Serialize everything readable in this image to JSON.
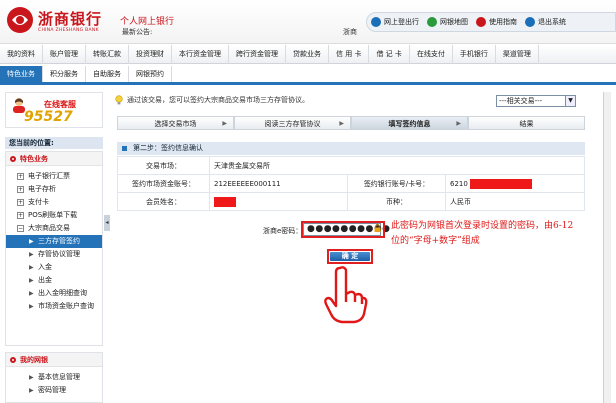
{
  "header": {
    "bank_name": "浙商银行",
    "bank_name_en": "CHINA ZHESHANG BANK",
    "site_title": "个人网上银行",
    "last_login_label": "最新公告:",
    "user_fragment": "浙商",
    "top_links": [
      {
        "label": "网上登出行",
        "icon": "user-icon",
        "color": "#1a6fb8"
      },
      {
        "label": "网银地图",
        "icon": "map-icon",
        "color": "#2a9a3a"
      },
      {
        "label": "使用指南",
        "icon": "help-icon",
        "color": "#c9161d"
      },
      {
        "label": "退出系统",
        "icon": "exit-icon",
        "color": "#1a6fb8"
      }
    ]
  },
  "nav_primary": [
    "我的资料",
    "账户管理",
    "转账汇款",
    "投资理财",
    "本行资金管理",
    "跨行资金管理",
    "贷款业务",
    "信 用 卡",
    "借 记 卡",
    "在线支付",
    "手机银行",
    "渠道管理"
  ],
  "nav_secondary": [
    {
      "label": "特色业务",
      "active": true
    },
    {
      "label": "积分服务",
      "active": false
    },
    {
      "label": "自助服务",
      "active": false
    },
    {
      "label": "网银预约",
      "active": false
    }
  ],
  "sidebar": {
    "customer_service_title": "在线客服",
    "customer_service_phone": "95527",
    "location_label": "您当前的位置:",
    "section_title": "特色业务",
    "items": [
      {
        "label": "电子银行汇票",
        "level": 1
      },
      {
        "label": "电子存析",
        "level": 1
      },
      {
        "label": "支付卡",
        "level": 1
      },
      {
        "label": "POS刷账单下载",
        "level": 1
      },
      {
        "label": "大宗商品交易",
        "level": 1
      },
      {
        "label": "三方存管签约",
        "level": 2,
        "active": true
      },
      {
        "label": "存管协议管理",
        "level": 2
      },
      {
        "label": "入金",
        "level": 2
      },
      {
        "label": "出金",
        "level": 2
      },
      {
        "label": "出入金明细查询",
        "level": 2
      },
      {
        "label": "市场资金账户查询",
        "level": 2
      }
    ],
    "section2_title": "我的网银",
    "items2": [
      "基本信息管理",
      "密码管理"
    ]
  },
  "main": {
    "notice": "通过该交易，您可以签约大宗商品交易市场三方存管协议。",
    "market_select_value": "---相关交易---",
    "steps": [
      "选择交易市场",
      "阅读三方存管协议",
      "填写签约信息",
      "结果"
    ],
    "active_step": 2,
    "step_title": "第二步：签约信息确认",
    "rows": [
      {
        "label": "交易市场：",
        "value": "天津贵金属交易所"
      },
      {
        "label": "签约市场资金账号：",
        "value": "212EEEEEE000111",
        "label2": "签约银行账号/卡号：",
        "value2": "6210"
      },
      {
        "label": "会员姓名：",
        "value": "",
        "label2": "币种：",
        "value2": "人民币"
      }
    ],
    "password_label": "浙商e密码：",
    "password_value": "●●●●●●●●●●",
    "annotation": "此密码为网银首次登录时设置的密码，由6-12位的“字母+数字”组成",
    "confirm_label": "确 定"
  },
  "colors": {
    "brand_red": "#c9161d",
    "nav_blue": "#2473b8",
    "annotation_red": "#e01818"
  }
}
